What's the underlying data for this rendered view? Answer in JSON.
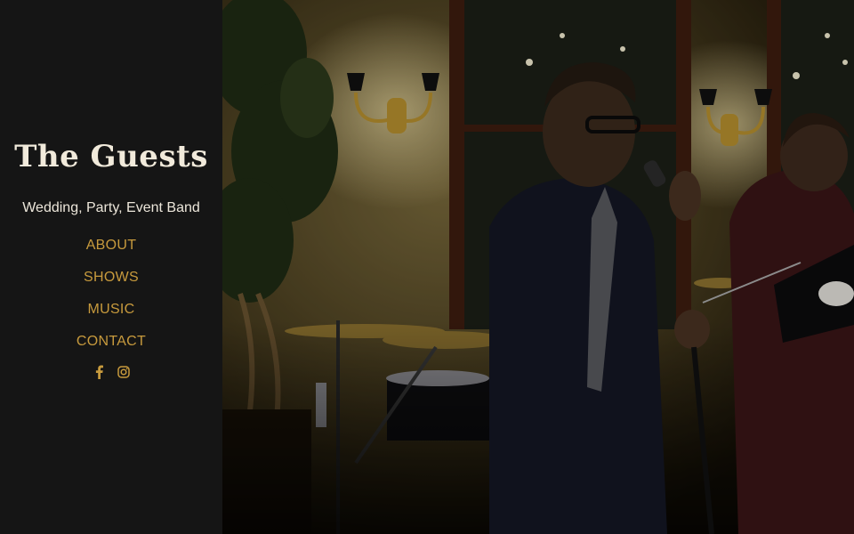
{
  "site": {
    "title": "The Guests",
    "tagline": "Wedding, Party, Event Band"
  },
  "nav": {
    "items": [
      {
        "label": "ABOUT"
      },
      {
        "label": "SHOWS"
      },
      {
        "label": "MUSIC"
      },
      {
        "label": "CONTACT"
      }
    ]
  },
  "social": {
    "icons": [
      "facebook-icon",
      "instagram-icon"
    ]
  },
  "colors": {
    "sidebar_bg": "#151515",
    "title": "#f1eadb",
    "nav_link": "#c79a3d"
  }
}
